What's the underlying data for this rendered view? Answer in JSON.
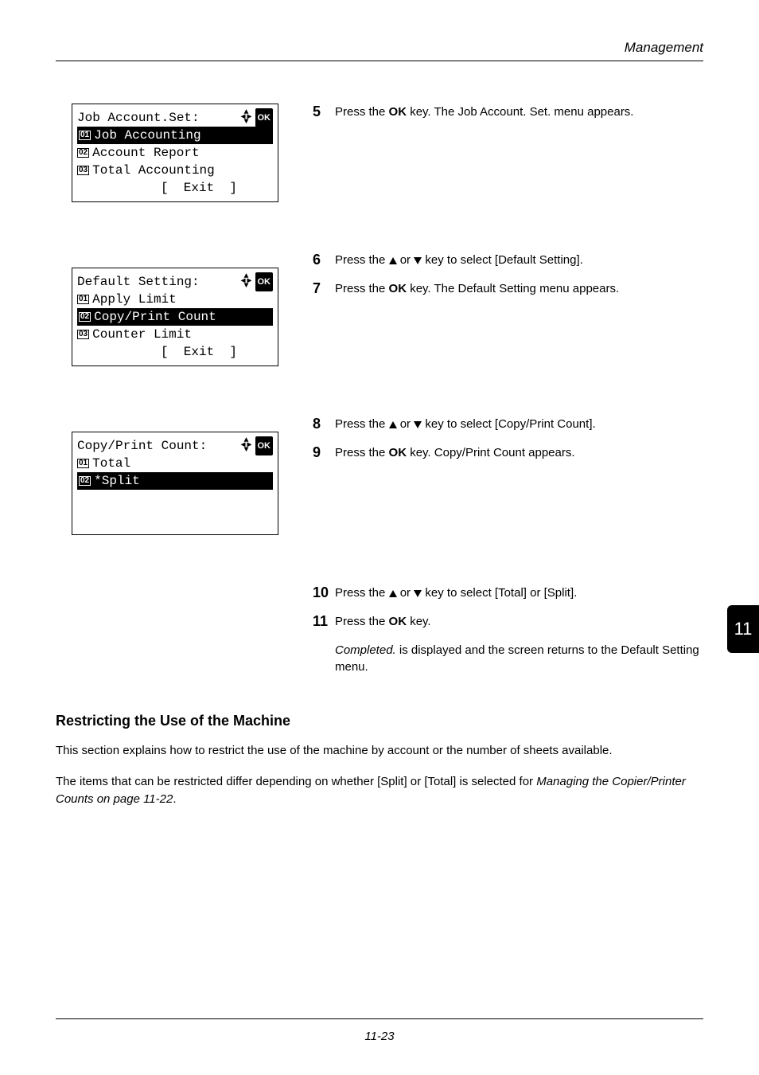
{
  "header": {
    "section": "Management"
  },
  "lcd1": {
    "title_left": "Job Account.Set:",
    "ok": "OK",
    "line1_num": "01",
    "line1_label": "Job Accounting",
    "line2_num": "02",
    "line2_label": "Account Report",
    "line3_num": "03",
    "line3_label": "Total Accounting",
    "exit": "[  Exit  ]"
  },
  "lcd2": {
    "title_left": "Default Setting:",
    "ok": "OK",
    "line1_num": "01",
    "line1_label": "Apply Limit",
    "line2_num": "02",
    "line2_label": "Copy/Print Count",
    "line3_num": "03",
    "line3_label": "Counter Limit",
    "exit": "[  Exit  ]"
  },
  "lcd3": {
    "title_left": "Copy/Print Count:",
    "ok": "OK",
    "line1_num": "01",
    "line1_label": "Total",
    "line2_num": "02",
    "line2_label": "*Split"
  },
  "steps": {
    "s5": {
      "n": "5",
      "pre": "Press the ",
      "key": "OK",
      "post": " key. The Job Account. Set. menu appears."
    },
    "s6": {
      "n": "6",
      "pre": "Press the ",
      "mid": " or ",
      "post": " key to select [Default Setting]."
    },
    "s7": {
      "n": "7",
      "pre": "Press the ",
      "key": "OK",
      "post": " key. The Default Setting menu appears."
    },
    "s8": {
      "n": "8",
      "pre": "Press the ",
      "mid": " or ",
      "post": " key to select [Copy/Print Count]."
    },
    "s9": {
      "n": "9",
      "pre": "Press the ",
      "key": "OK",
      "post": " key. Copy/Print Count appears."
    },
    "s10": {
      "n": "10",
      "pre": "Press the ",
      "mid": " or ",
      "post": " key to select [Total] or [Split]."
    },
    "s11": {
      "n": "11",
      "pre": "Press the ",
      "key": "OK",
      "post": " key."
    },
    "s11_note_pre": "Completed.",
    "s11_note_post": " is displayed and the screen returns to the Default Setting menu."
  },
  "section": {
    "heading": "Restricting the Use of the Machine",
    "para1": "This section explains how to restrict the use of the machine by account or the number of sheets available.",
    "para2_pre": "The items that can be restricted differ depending on whether [Split] or [Total] is selected for ",
    "para2_ital": "Managing the Copier/Printer Counts on page 11-22",
    "para2_post": "."
  },
  "side_tab": "11",
  "footer": "11-23"
}
